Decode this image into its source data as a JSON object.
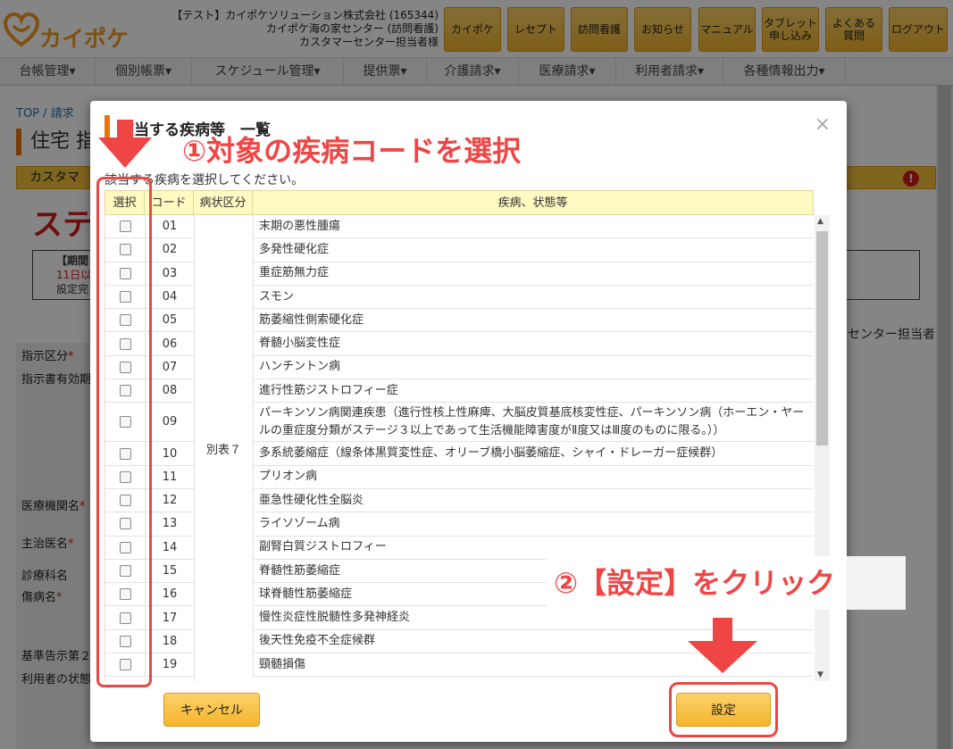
{
  "header": {
    "brand": "カイポケ",
    "org_lines": [
      "【テスト】カイポケソリューション株式会社 (165344)",
      "カイポケ海の家センター (訪問看護)",
      "カスタマーセンター担当者様"
    ],
    "nav": [
      "カイポケ",
      "レセプト",
      "訪問看護",
      "お知らせ",
      "マニュアル",
      "タブレット\n申し込み",
      "よくある\n質問",
      "ログアウト"
    ]
  },
  "menu": [
    "台帳管理▾",
    "個別帳票▾",
    "スケジュール管理▾",
    "提供票▾",
    "介護請求▾",
    "医療請求▾",
    "利用者請求▾",
    "各種情報出力▾"
  ],
  "background": {
    "breadcrumb": "TOP  /  請求",
    "page_title": "住宅 指",
    "customer_bar": "カスタマ",
    "alert_icon": "!",
    "big_red": "ステ",
    "period_line1": "【期間",
    "period_line2": "11日以",
    "period_line3": "設定完",
    "side_user": "センター担当者",
    "form_labels": [
      {
        "text": "指示区分",
        "req": true
      },
      {
        "text": "指示書有効期",
        "req": false
      },
      {
        "text": "医療機関名",
        "req": true
      },
      {
        "text": "主治医名",
        "req": true
      },
      {
        "text": "診療科名",
        "req": false
      },
      {
        "text": "傷病名",
        "req": true
      },
      {
        "text": "基準告示第２",
        "req": false
      },
      {
        "text": "利用者の状態",
        "req": false
      }
    ]
  },
  "modal": {
    "title": "該当する疾病等　一覧",
    "close": "×",
    "description": "該当する疾病を選択してください。",
    "columns": [
      "選択",
      "コード",
      "病状区分",
      "疾病、状態等"
    ],
    "category": "別表７",
    "rows": [
      {
        "code": "01",
        "name": "末期の悪性腫瘍"
      },
      {
        "code": "02",
        "name": "多発性硬化症"
      },
      {
        "code": "03",
        "name": "重症筋無力症"
      },
      {
        "code": "04",
        "name": "スモン"
      },
      {
        "code": "05",
        "name": "筋萎縮性側索硬化症"
      },
      {
        "code": "06",
        "name": "脊髄小脳変性症"
      },
      {
        "code": "07",
        "name": "ハンチントン病"
      },
      {
        "code": "08",
        "name": "進行性筋ジストロフィー症"
      },
      {
        "code": "09",
        "name": "パーキンソン病関連疾患（進行性核上性麻痺、大脳皮質基底核変性症、パーキンソン病（ホーエン・ヤールの重症度分類がステージ３以上であって生活機能障害度がⅡ度又はⅢ度のものに限る。））"
      },
      {
        "code": "10",
        "name": "多系統萎縮症（線条体黒質変性症、オリーブ橋小脳萎縮症、シャイ・ドレーガー症候群）"
      },
      {
        "code": "11",
        "name": "プリオン病"
      },
      {
        "code": "12",
        "name": "亜急性硬化性全脳炎"
      },
      {
        "code": "13",
        "name": "ライソゾーム病"
      },
      {
        "code": "14",
        "name": "副腎白質ジストロフィー"
      },
      {
        "code": "15",
        "name": "脊髄性筋萎縮症"
      },
      {
        "code": "16",
        "name": "球脊髄性筋萎縮症"
      },
      {
        "code": "17",
        "name": "慢性炎症性脱髄性多発神経炎"
      },
      {
        "code": "18",
        "name": "後天性免疫不全症候群"
      },
      {
        "code": "19",
        "name": "頸髄損傷"
      }
    ],
    "cancel_label": "キャンセル",
    "submit_label": "設定"
  },
  "annotations": {
    "step1": "①対象の疾病コードを選択",
    "step2": "②【設定】をクリック",
    "color": "#f04545"
  }
}
